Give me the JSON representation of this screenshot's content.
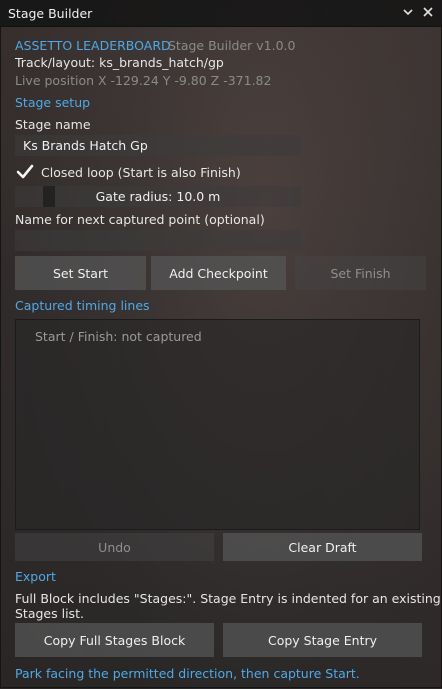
{
  "window": {
    "title": "Stage Builder",
    "collapse_icon": "chevron-down-icon",
    "close_icon": "close-icon"
  },
  "header": {
    "app_name": "ASSETTO LEADERBOARD",
    "version": "Stage Builder v1.0.0",
    "track": "Track/layout: ks_brands_hatch/gp",
    "live_position": "Live position  X -129.24   Y -9.80   Z -371.82"
  },
  "stage_setup": {
    "section_title": "Stage setup",
    "stage_name_label": "Stage name",
    "stage_name_value": "Ks Brands Hatch Gp",
    "closed_loop_label": "Closed loop (Start is also Finish)",
    "closed_loop_checked": true,
    "gate_radius_label": "Gate radius: 10.0 m",
    "gate_radius_value": 10.0,
    "next_point_label": "Name for next captured point (optional)",
    "next_point_value": ""
  },
  "capture_buttons": {
    "set_start": "Set Start",
    "add_checkpoint": "Add Checkpoint",
    "set_finish": "Set Finish"
  },
  "timing": {
    "section_title": "Captured timing lines",
    "entries": [
      "Start / Finish: not captured"
    ]
  },
  "draft_buttons": {
    "undo": "Undo",
    "clear_draft": "Clear Draft"
  },
  "export": {
    "section_title": "Export",
    "description_line1": "Full Block includes \"Stages:\". Stage Entry is indented for an existing",
    "description_line2": "Stages list.",
    "copy_full": "Copy Full Stages Block",
    "copy_entry": "Copy Stage Entry"
  },
  "footer_hint": "Park facing the permitted direction, then capture Start.",
  "colors": {
    "accent": "#4fa9e6",
    "button": "#555555",
    "disabled_text": "#8f8f8f"
  }
}
